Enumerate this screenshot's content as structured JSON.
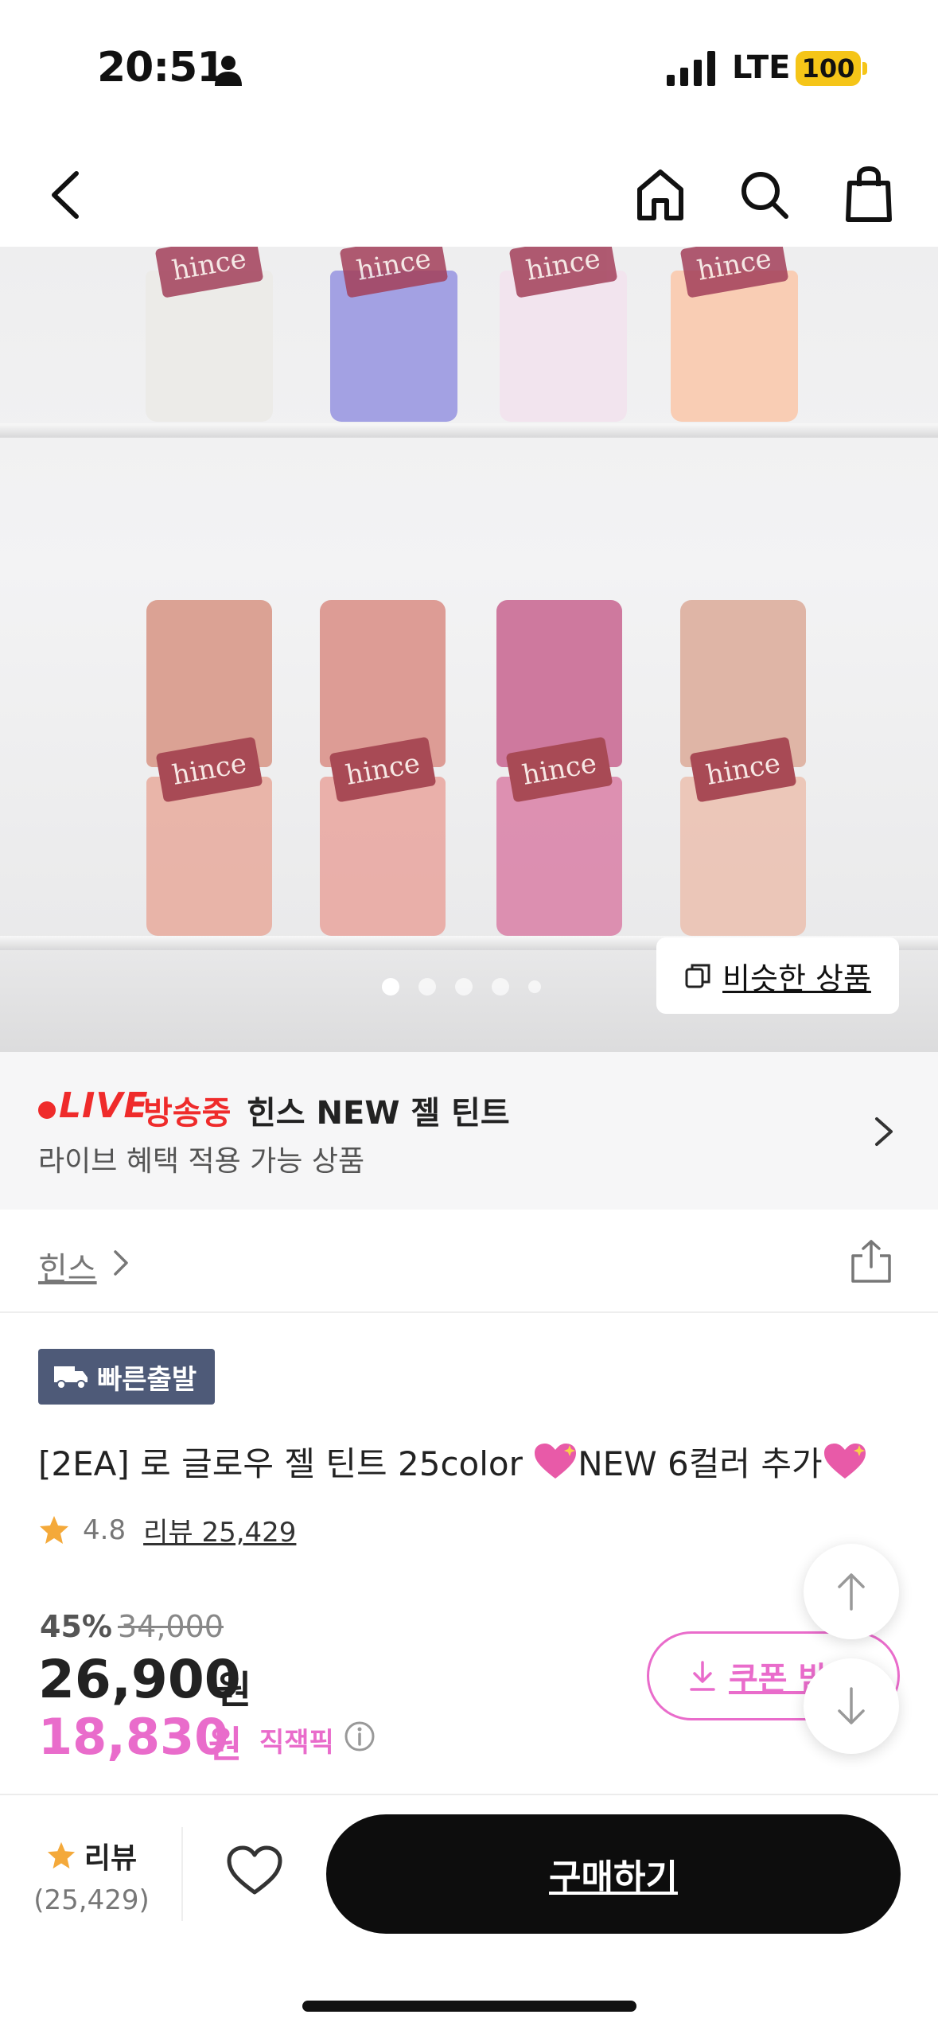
{
  "status_bar": {
    "time": "20:51",
    "network": "LTE",
    "battery": "100"
  },
  "nav": {
    "back_icon": "chevron-left-icon",
    "home_icon": "home-icon",
    "search_icon": "search-icon",
    "cart_icon": "shopping-bag-icon"
  },
  "hero": {
    "bottle_brand": "hince",
    "carousel_pages": 5,
    "carousel_active": 1,
    "similar_button": "비슷한 상품",
    "top_row_colors": [
      "#ecebe8",
      "#a3a1e3",
      "#f2e4ee",
      "#f9cdb4"
    ],
    "bottom_row_colors": [
      "#e7aa9c",
      "#e9a49d",
      "#d97fa6",
      "#ebbfaf"
    ]
  },
  "live": {
    "live_word": "LIVE",
    "on_air": "방송중",
    "title": "힌스 NEW 젤 틴트",
    "subtitle": "라이브 혜택 적용 가능 상품"
  },
  "brand": {
    "name": "힌스"
  },
  "product": {
    "badge": "빠른출발",
    "title_prefix": "[2EA] 로 글로우 젤 틴트 25color ",
    "title_middle": "NEW 6컬러 추가",
    "rating": "4.8",
    "review_link": "리뷰 25,429",
    "discount": "45%",
    "original_price": "34,000",
    "price": "26,900",
    "price_unit": "원",
    "pick_price": "18,830",
    "pick_unit": "원",
    "pick_label": "직잭픽",
    "coupon_button": "쿠폰 받"
  },
  "bottom_bar": {
    "review_label": "리뷰",
    "review_count": "(25,429)",
    "buy_button": "구매하기"
  },
  "colors": {
    "accent_pink": "#e96ccb",
    "live_red": "#ef2b2b",
    "badge_navy": "#4e5a78",
    "star": "#f4a93a"
  }
}
